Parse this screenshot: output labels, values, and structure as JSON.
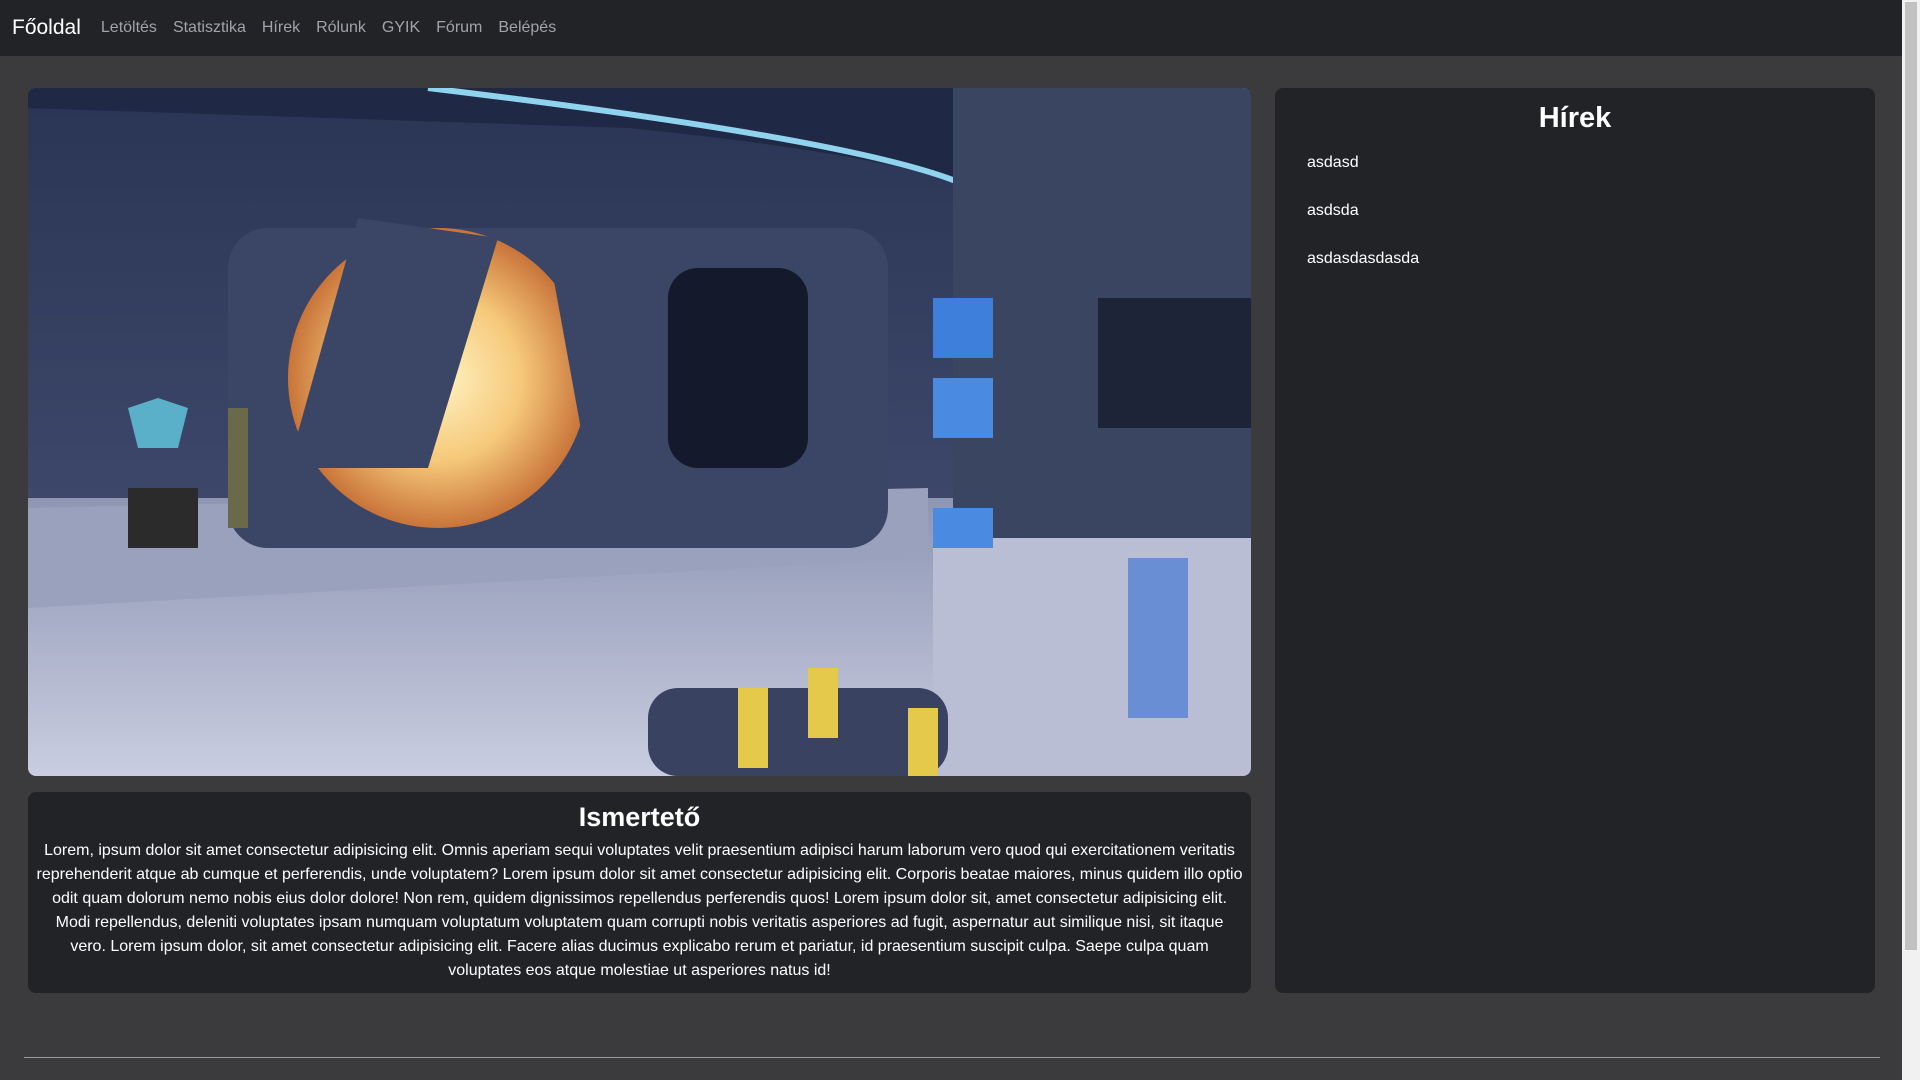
{
  "nav": {
    "brand": "Főoldal",
    "links": [
      "Letöltés",
      "Statisztika",
      "Hírek",
      "Rólunk",
      "GYIK",
      "Fórum",
      "Belépés"
    ]
  },
  "about": {
    "title": "Ismertető",
    "text": "Lorem, ipsum dolor sit amet consectetur adipisicing elit. Omnis aperiam sequi voluptates velit praesentium adipisci harum laborum vero quod qui exercitationem veritatis reprehenderit atque ab cumque et perferendis, unde voluptatem? Lorem ipsum dolor sit amet consectetur adipisicing elit. Corporis beatae maiores, minus quidem illo optio odit quam dolorum nemo nobis eius dolor dolore! Non rem, quidem dignissimos repellendus perferendis quos! Lorem ipsum dolor sit, amet consectetur adipisicing elit. Modi repellendus, deleniti voluptates ipsam numquam voluptatum voluptatem quam corrupti nobis veritatis asperiores ad fugit, aspernatur aut similique nisi, sit itaque vero. Lorem ipsum dolor, sit amet consectetur adipisicing elit. Facere alias ducimus explicabo rerum et pariatur, id praesentium suscipit culpa. Saepe culpa quam voluptates eos atque molestiae ut asperiores natus id!"
  },
  "news": {
    "title": "Hírek",
    "items": [
      "asdasd",
      "asdsda",
      "asdasdasdasda"
    ]
  },
  "colors": {
    "navbar_bg": "#212327",
    "page_bg": "#3b3a3c",
    "card_bg": "#212327",
    "nav_link": "#a0a3a8"
  }
}
